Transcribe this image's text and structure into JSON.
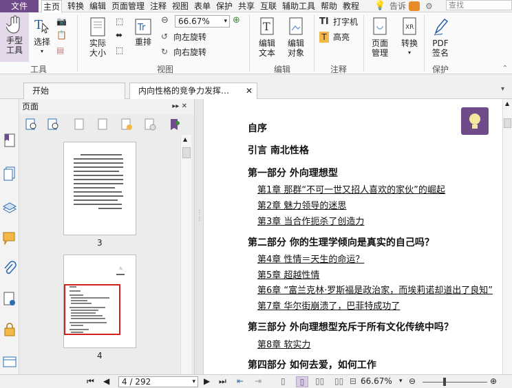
{
  "menubar": {
    "file": "文件",
    "items": [
      "主页",
      "转换",
      "编辑",
      "页面管理",
      "注释",
      "视图",
      "表单",
      "保护",
      "共享",
      "互联",
      "辅助工具",
      "帮助",
      "教程"
    ],
    "tell_me": "告诉",
    "search_placeholder": "查找"
  },
  "ribbon": {
    "tools": {
      "hand": "手型\n工具",
      "select": "选择",
      "group": "工具"
    },
    "view": {
      "actual_size": "实际\n大小",
      "reflow": "重排",
      "zoom": "66.67%",
      "rotate_left": "向左旋转",
      "rotate_right": "向右旋转",
      "group": "视图"
    },
    "edit": {
      "edit_text": "编辑\n文本",
      "edit_object": "编辑\n对象",
      "group": "编辑"
    },
    "comment": {
      "typewriter": "打字机",
      "highlight": "高亮",
      "group": "注释"
    },
    "pages": {
      "manage": "页面\n管理"
    },
    "convert": {
      "label": "转换"
    },
    "protect": {
      "pdf_sign": "PDF\n签名",
      "group": "保护"
    }
  },
  "tabs": {
    "start": "开始",
    "doc": "内向性格的竞争力发挥…"
  },
  "panel": {
    "title": "页面",
    "thumb1_num": "3",
    "thumb2_num": "4"
  },
  "document": {
    "lines": [
      {
        "kind": "part",
        "text": "自序"
      },
      {
        "kind": "part",
        "text": "引言 南北性格"
      },
      {
        "kind": "part",
        "text": "第一部分 外向理想型"
      },
      {
        "kind": "chap",
        "text": "第1章 那群“不可一世又招人喜欢的家伙”的崛起"
      },
      {
        "kind": "chap",
        "text": "第2章 魅力领导的迷思"
      },
      {
        "kind": "chap",
        "text": "第3章 当合作扼杀了创造力"
      },
      {
        "kind": "part",
        "text": "第二部分 你的生理学倾向是真实的自己吗？"
      },
      {
        "kind": "chap",
        "text": "第4章 性情＝天生的命运？"
      },
      {
        "kind": "chap",
        "text": "第5章 超越性情"
      },
      {
        "kind": "chap",
        "text": "第6章 “富兰克林·罗斯福是政治家，而埃莉诺却道出了良知”"
      },
      {
        "kind": "chap",
        "text": "第7章 华尔街崩溃了，巴菲特成功了"
      },
      {
        "kind": "part",
        "text": "第三部分 外向理想型充斥于所有文化传统中吗？"
      },
      {
        "kind": "chap",
        "text": "第8章 软实力"
      },
      {
        "kind": "part",
        "text": "第四部分 如何去爱，如何工作"
      }
    ]
  },
  "status": {
    "page": "4 / 292",
    "zoom": "66.67%"
  },
  "colors": {
    "accent": "#6f4b89"
  }
}
